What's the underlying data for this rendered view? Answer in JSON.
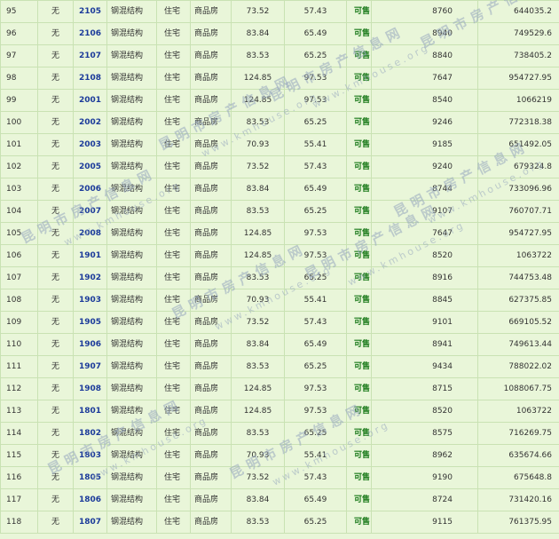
{
  "rows": [
    [
      "95",
      "无",
      "2105",
      "钢混结构",
      "住宅",
      "商品房",
      "73.52",
      "57.43",
      "可售",
      "8760",
      "644035.2"
    ],
    [
      "96",
      "无",
      "2106",
      "钢混结构",
      "住宅",
      "商品房",
      "83.84",
      "65.49",
      "可售",
      "8940",
      "749529.6"
    ],
    [
      "97",
      "无",
      "2107",
      "钢混结构",
      "住宅",
      "商品房",
      "83.53",
      "65.25",
      "可售",
      "8840",
      "738405.2"
    ],
    [
      "98",
      "无",
      "2108",
      "钢混结构",
      "住宅",
      "商品房",
      "124.85",
      "97.53",
      "可售",
      "7647",
      "954727.95"
    ],
    [
      "99",
      "无",
      "2001",
      "钢混结构",
      "住宅",
      "商品房",
      "124.85",
      "97.53",
      "可售",
      "8540",
      "1066219"
    ],
    [
      "100",
      "无",
      "2002",
      "钢混结构",
      "住宅",
      "商品房",
      "83.53",
      "65.25",
      "可售",
      "9246",
      "772318.38"
    ],
    [
      "101",
      "无",
      "2003",
      "钢混结构",
      "住宅",
      "商品房",
      "70.93",
      "55.41",
      "可售",
      "9185",
      "651492.05"
    ],
    [
      "102",
      "无",
      "2005",
      "钢混结构",
      "住宅",
      "商品房",
      "73.52",
      "57.43",
      "可售",
      "9240",
      "679324.8"
    ],
    [
      "103",
      "无",
      "2006",
      "钢混结构",
      "住宅",
      "商品房",
      "83.84",
      "65.49",
      "可售",
      "8744",
      "733096.96"
    ],
    [
      "104",
      "无",
      "2007",
      "钢混结构",
      "住宅",
      "商品房",
      "83.53",
      "65.25",
      "可售",
      "9107",
      "760707.71"
    ],
    [
      "105",
      "无",
      "2008",
      "钢混结构",
      "住宅",
      "商品房",
      "124.85",
      "97.53",
      "可售",
      "7647",
      "954727.95"
    ],
    [
      "106",
      "无",
      "1901",
      "钢混结构",
      "住宅",
      "商品房",
      "124.85",
      "97.53",
      "可售",
      "8520",
      "1063722"
    ],
    [
      "107",
      "无",
      "1902",
      "钢混结构",
      "住宅",
      "商品房",
      "83.53",
      "65.25",
      "可售",
      "8916",
      "744753.48"
    ],
    [
      "108",
      "无",
      "1903",
      "钢混结构",
      "住宅",
      "商品房",
      "70.93",
      "55.41",
      "可售",
      "8845",
      "627375.85"
    ],
    [
      "109",
      "无",
      "1905",
      "钢混结构",
      "住宅",
      "商品房",
      "73.52",
      "57.43",
      "可售",
      "9101",
      "669105.52"
    ],
    [
      "110",
      "无",
      "1906",
      "钢混结构",
      "住宅",
      "商品房",
      "83.84",
      "65.49",
      "可售",
      "8941",
      "749613.44"
    ],
    [
      "111",
      "无",
      "1907",
      "钢混结构",
      "住宅",
      "商品房",
      "83.53",
      "65.25",
      "可售",
      "9434",
      "788022.02"
    ],
    [
      "112",
      "无",
      "1908",
      "钢混结构",
      "住宅",
      "商品房",
      "124.85",
      "97.53",
      "可售",
      "8715",
      "1088067.75"
    ],
    [
      "113",
      "无",
      "1801",
      "钢混结构",
      "住宅",
      "商品房",
      "124.85",
      "97.53",
      "可售",
      "8520",
      "1063722"
    ],
    [
      "114",
      "无",
      "1802",
      "钢混结构",
      "住宅",
      "商品房",
      "83.53",
      "65.25",
      "可售",
      "8575",
      "716269.75"
    ],
    [
      "115",
      "无",
      "1803",
      "钢混结构",
      "住宅",
      "商品房",
      "70.93",
      "55.41",
      "可售",
      "8962",
      "635674.66"
    ],
    [
      "116",
      "无",
      "1805",
      "钢混结构",
      "住宅",
      "商品房",
      "73.52",
      "57.43",
      "可售",
      "9190",
      "675648.8"
    ],
    [
      "117",
      "无",
      "1806",
      "钢混结构",
      "住宅",
      "商品房",
      "83.84",
      "65.49",
      "可售",
      "8724",
      "731420.16"
    ],
    [
      "118",
      "无",
      "1807",
      "钢混结构",
      "住宅",
      "商品房",
      "83.53",
      "65.25",
      "可售",
      "9115",
      "761375.95"
    ]
  ],
  "watermark": {
    "cn": "昆明市房产信息网",
    "en": "www.kmhouse.org"
  }
}
